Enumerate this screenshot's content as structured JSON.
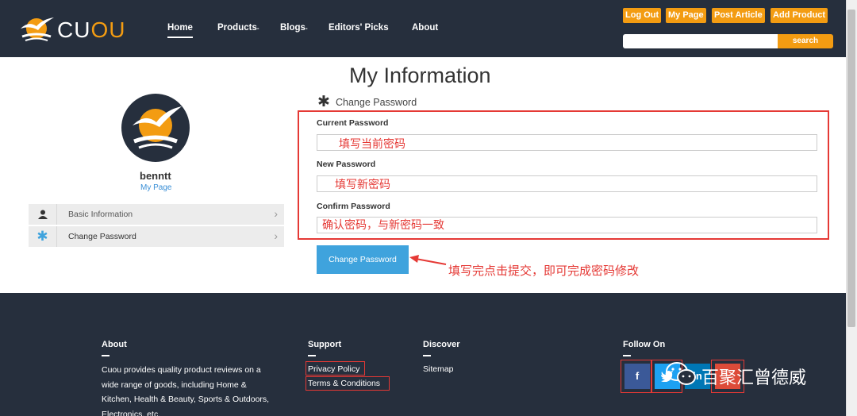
{
  "header": {
    "logo_cu": "CU",
    "logo_ou": "OU",
    "nav": [
      {
        "label": "Home"
      },
      {
        "label": "Products"
      },
      {
        "label": "Blogs"
      },
      {
        "label": "Editors' Picks"
      },
      {
        "label": "About"
      }
    ],
    "buttons": {
      "logout": "Log Out",
      "mypage": "My Page",
      "post_article": "Post Article",
      "add_product": "Add Product"
    },
    "search": {
      "button": "search",
      "placeholder": ""
    }
  },
  "main": {
    "title": "My Information",
    "profile": {
      "username": "benntt",
      "link": "My Page"
    },
    "sidebar": [
      {
        "label": "Basic Information",
        "icon": "user-icon"
      },
      {
        "label": "Change Password",
        "icon": "asterisk-icon"
      }
    ],
    "form": {
      "section_title": "Change Password",
      "fields": [
        {
          "label": "Current Password",
          "hint": "填写当前密码",
          "value": ""
        },
        {
          "label": "New Password",
          "hint": "填写新密码",
          "value": ""
        },
        {
          "label": "Confirm Password",
          "hint": "确认密码，与新密码一致",
          "value": ""
        }
      ],
      "submit": "Change Password",
      "note": "填写完点击提交，即可完成密码修改"
    }
  },
  "footer": {
    "about": {
      "heading": "About",
      "text": "Cuou provides quality product reviews on a wide range of goods, including Home & Kitchen, Health & Beauty, Sports & Outdoors, Electronics, etc."
    },
    "support": {
      "heading": "Support",
      "links": [
        "Privacy Policy",
        "Terms & Conditions"
      ]
    },
    "discover": {
      "heading": "Discover",
      "links": [
        "Sitemap"
      ]
    },
    "follow": {
      "heading": "Follow On",
      "social": [
        "f",
        "",
        "in",
        ""
      ]
    },
    "watermark": "百聚汇曾德威"
  },
  "colors": {
    "header_bg": "#262f3d",
    "accent": "#f39c12",
    "primary": "#3fa3dd",
    "annotation": "#e53935"
  }
}
